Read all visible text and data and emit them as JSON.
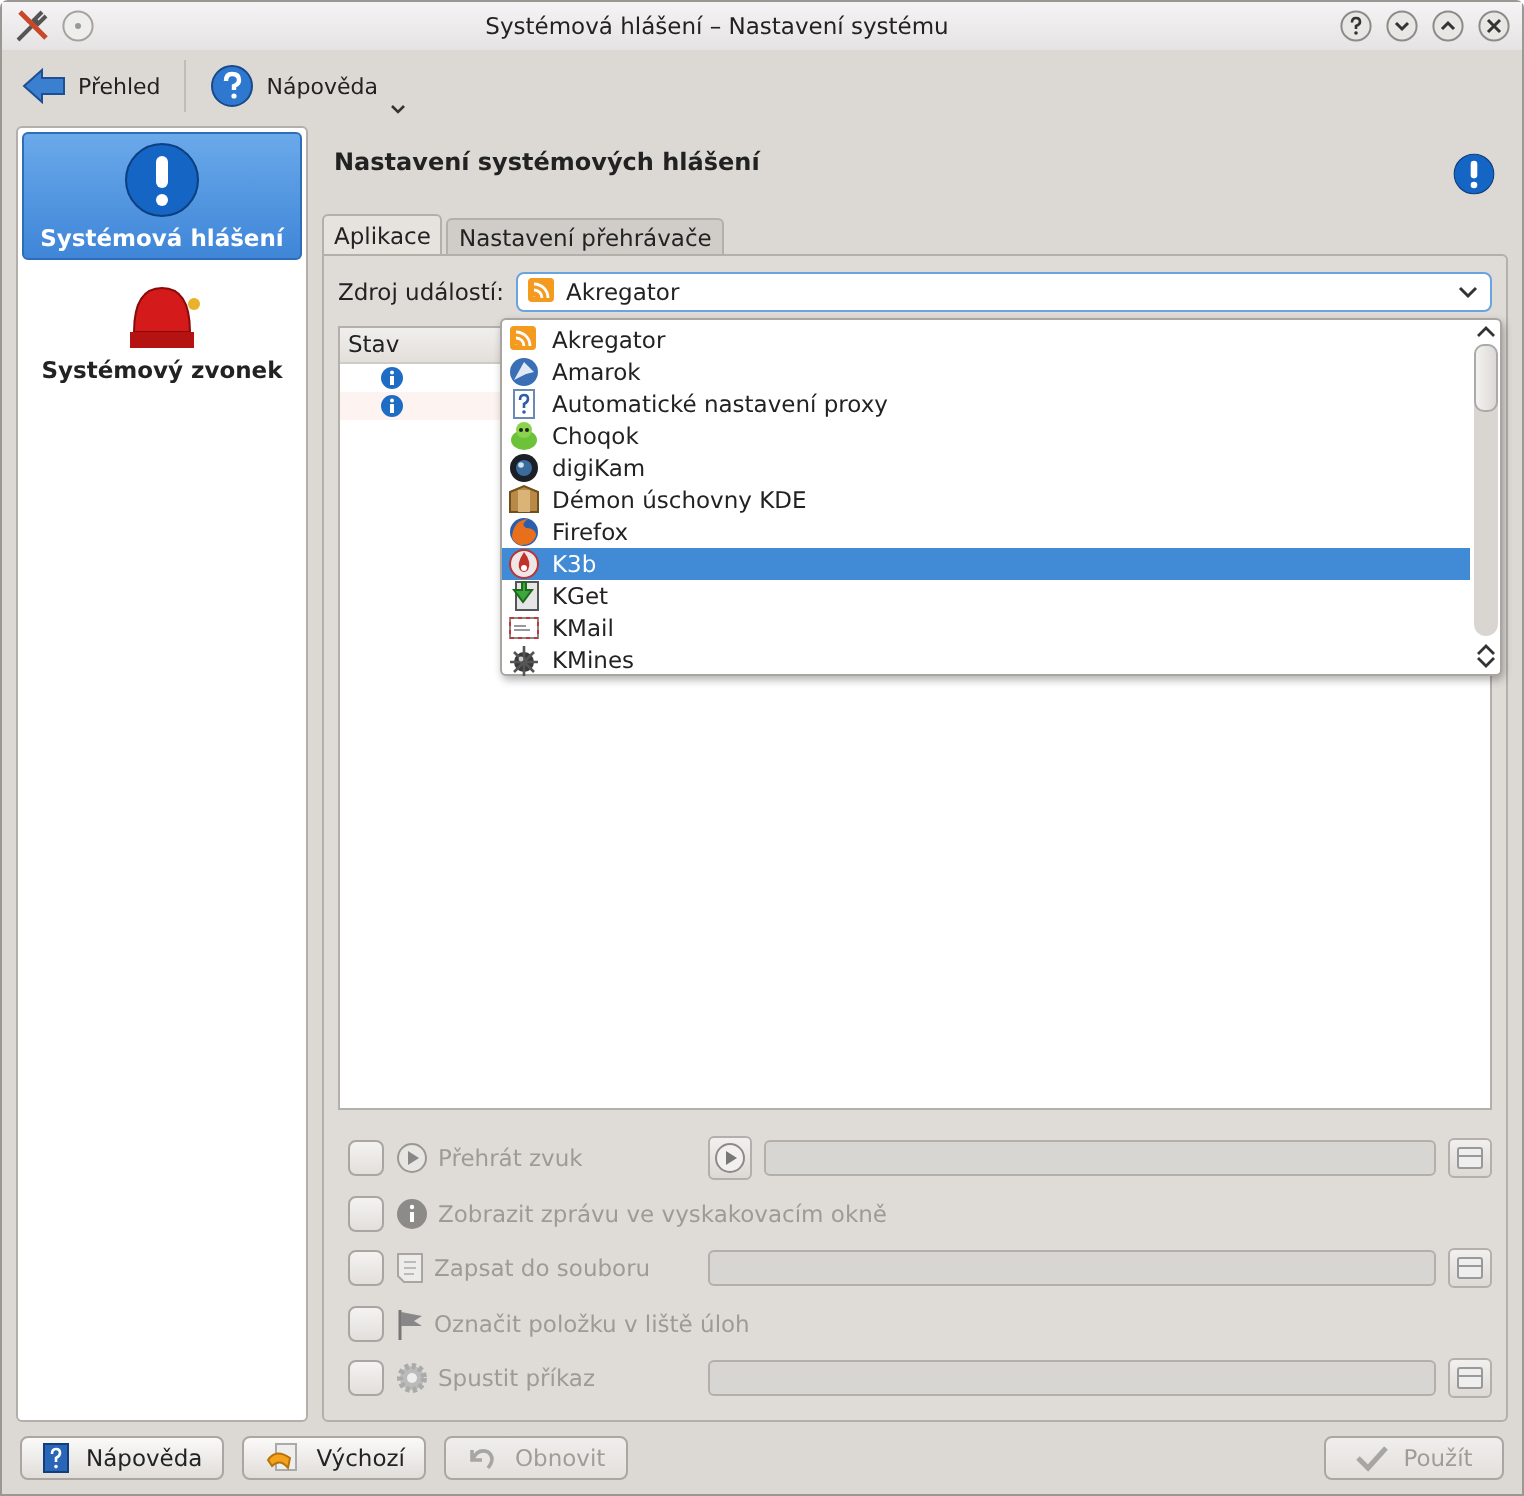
{
  "window": {
    "title": "Systémová hlášení – Nastavení systému"
  },
  "toolbar": [
    {
      "kind": "back",
      "label": "Přehled",
      "menu": false
    },
    {
      "kind": "help",
      "label": "Nápověda",
      "menu": true
    }
  ],
  "sidebar": {
    "items": [
      {
        "kind": "notify",
        "label": "Systémová hlášení",
        "selected": true
      },
      {
        "kind": "bell",
        "label": "Systémový zvonek",
        "selected": false
      }
    ]
  },
  "page": {
    "title": "Nastavení systémových hlášení"
  },
  "tabs": [
    {
      "label": "Aplikace",
      "selected": true
    },
    {
      "label": "Nastavení přehrávače",
      "selected": false
    }
  ],
  "source": {
    "label": "Zdroj událostí:",
    "value": "Akregator",
    "expanded": true,
    "options": [
      {
        "label": "Akregator",
        "highlighted": false
      },
      {
        "label": "Amarok",
        "highlighted": false
      },
      {
        "label": "Automatické nastavení proxy",
        "highlighted": false
      },
      {
        "label": "Choqok",
        "highlighted": false
      },
      {
        "label": "digiKam",
        "highlighted": false
      },
      {
        "label": "Démon úschovny KDE",
        "highlighted": false
      },
      {
        "label": "Firefox",
        "highlighted": false
      },
      {
        "label": "K3b",
        "highlighted": true
      },
      {
        "label": "KGet",
        "highlighted": false
      },
      {
        "label": "KMail",
        "highlighted": false
      },
      {
        "label": "KMines",
        "highlighted": false
      }
    ]
  },
  "events": {
    "columns": [
      "Stav"
    ],
    "rows": [
      {
        "kind": "info"
      },
      {
        "kind": "info"
      }
    ]
  },
  "actions": [
    {
      "kind": "sound",
      "label": "Přehrát zvuk",
      "checked": false,
      "disabled": true
    },
    {
      "kind": "popup",
      "label": "Zobrazit zprávu ve vyskakovacím okně",
      "checked": false,
      "disabled": true
    },
    {
      "kind": "file",
      "label": "Zapsat do souboru",
      "checked": false,
      "disabled": true
    },
    {
      "kind": "taskbar",
      "label": "Označit položku v liště úloh",
      "checked": false,
      "disabled": true
    },
    {
      "kind": "command",
      "label": "Spustit příkaz",
      "checked": false,
      "disabled": true
    }
  ],
  "buttons": [
    {
      "kind": "help",
      "label": "Nápověda",
      "disabled": false
    },
    {
      "kind": "defaults",
      "label": "Výchozí",
      "disabled": false
    },
    {
      "kind": "reset",
      "label": "Obnovit",
      "disabled": true
    },
    {
      "kind": "apply",
      "label": "Použít",
      "disabled": true
    }
  ]
}
